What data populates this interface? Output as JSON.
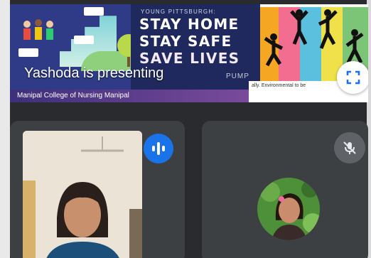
{
  "presentation": {
    "presenter_label": "Yashoda is presenting",
    "slide": {
      "kicker": "YOUNG PITTSBURGH:",
      "headline_lines": [
        "STAY HOME",
        "STAY SAFE",
        "SAVE LIVES"
      ],
      "logo_text": "PUMP",
      "caption_fragment": "ally. Environmental to be"
    },
    "footer_text": "Manipal College of Nursing Manipal",
    "fullscreen_icon": "fullscreen-icon"
  },
  "participants": [
    {
      "id": "yashoda",
      "state": "speaking",
      "indicator_icon": "audio-level-icon"
    },
    {
      "id": "second",
      "state": "muted",
      "indicator_icon": "mic-off-icon"
    }
  ],
  "colors": {
    "speaking_blue": "#1a73e8",
    "tile_bg": "#3c4043",
    "slide_navy": "#1f295d",
    "muted_grey": "#5f6368"
  }
}
